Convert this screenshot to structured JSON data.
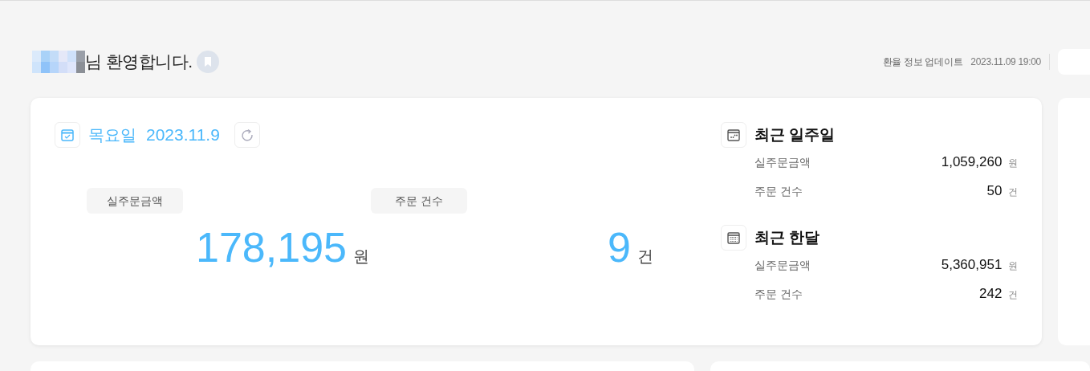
{
  "greeting": {
    "text": "님 환영합니다."
  },
  "exchange": {
    "label": "환율 정보 업데이트",
    "time": "2023.11.09 19:00"
  },
  "today": {
    "weekday": "목요일",
    "date": "2023.11.9",
    "stats": [
      {
        "label": "실주문금액",
        "value": "178,195",
        "unit": "원"
      },
      {
        "label": "주문 건수",
        "value": "9",
        "unit": "건"
      }
    ]
  },
  "periods": [
    {
      "kind": "week",
      "title": "최근 일주일",
      "rows": [
        {
          "label": "실주문금액",
          "value": "1,059,260",
          "unit": "원"
        },
        {
          "label": "주문 건수",
          "value": "50",
          "unit": "건"
        }
      ]
    },
    {
      "kind": "month",
      "title": "최근 한달",
      "rows": [
        {
          "label": "실주문금액",
          "value": "5,360,951",
          "unit": "원"
        },
        {
          "label": "주문 건수",
          "value": "242",
          "unit": "건"
        }
      ]
    }
  ]
}
